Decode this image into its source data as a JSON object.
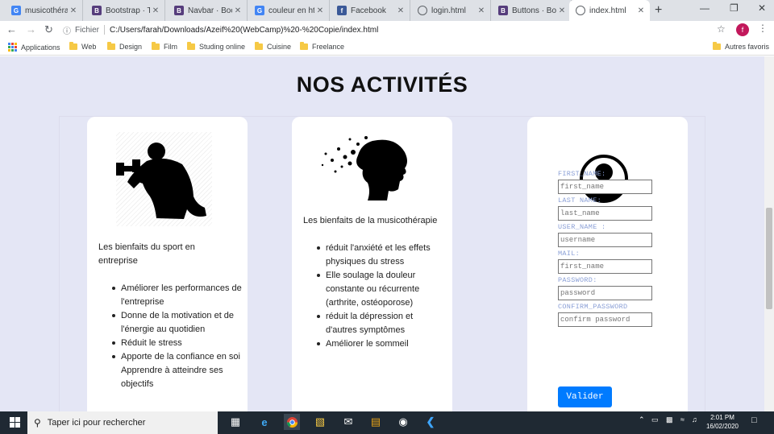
{
  "browser": {
    "tabs": [
      {
        "title": "musicothérapi",
        "favicon": "G",
        "color": "#4285f4"
      },
      {
        "title": "Bootstrap · The",
        "favicon": "B",
        "color": "#563d7c"
      },
      {
        "title": "Navbar · Boots",
        "favicon": "B",
        "color": "#563d7c"
      },
      {
        "title": "couleur en htm",
        "favicon": "G",
        "color": "#4285f4"
      },
      {
        "title": "Facebook",
        "favicon": "f",
        "color": "#3b5998"
      },
      {
        "title": "login.html",
        "favicon": "globe-icon",
        "color": "#5f6368"
      },
      {
        "title": "Buttons · Boot",
        "favicon": "B",
        "color": "#563d7c"
      },
      {
        "title": "index.html",
        "favicon": "globe-icon",
        "color": "#5f6368"
      }
    ],
    "new_tab": "+",
    "address": {
      "label": "Fichier",
      "url": "C:/Users/farah/Downloads/Azeif%20(WebCamp)%20-%20Copie/index.html"
    },
    "profile_initial": "f",
    "bookmarks": [
      "Applications",
      "Web",
      "Design",
      "Film",
      "Studing online",
      "Cuisine",
      "Freelance"
    ],
    "other_bookmarks": "Autres favoris"
  },
  "page": {
    "title": "NOS ACTIVITÉS",
    "card1": {
      "intro": "Les bienfaits du sport en entreprise",
      "items": [
        "Améliorer les performances de l'entreprise",
        "Donne de la motivation et de l'énergie au quotidien",
        "Réduit le stress",
        "Apporte de la confiance en soi",
        "Apprendre à atteindre ses objectifs"
      ]
    },
    "card2": {
      "intro": "Les bienfaits de la musicothérapie",
      "items": [
        "réduit l'anxiété et les effets physiques du stress",
        "Elle soulage la douleur constante ou récurrente (arthrite, ostéoporose)",
        "réduit la dépression et d'autres symptômes",
        "Améliorer le sommeil"
      ]
    },
    "form": {
      "fields": [
        {
          "label": "FIRST_NAME:",
          "placeholder": "first_name"
        },
        {
          "label": "LAST NAME:",
          "placeholder": "last_name"
        },
        {
          "label": "USER_NAME :",
          "placeholder": "username"
        },
        {
          "label": "MAIL:",
          "placeholder": "first_name"
        },
        {
          "label": "PASSWORD:",
          "placeholder": "password"
        },
        {
          "label": "CONFIRM_PASSWORD",
          "placeholder": "confirm password"
        }
      ],
      "submit": "Valider"
    }
  },
  "taskbar": {
    "search_placeholder": "Taper ici pour rechercher",
    "time": "2:01 PM",
    "date": "16/02/2020"
  }
}
